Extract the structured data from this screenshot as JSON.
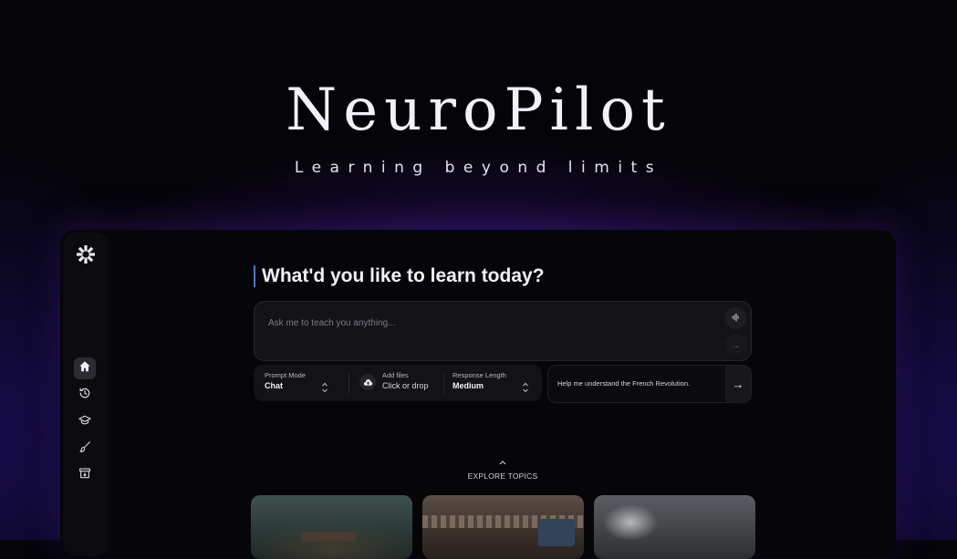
{
  "brand": {
    "title": "NeuroPilot",
    "tagline": "Learning beyond limits"
  },
  "sidebar": {
    "logo_icon": "asterisk-logo-icon",
    "items": [
      {
        "name": "home",
        "icon": "home-icon",
        "active": true
      },
      {
        "name": "history",
        "icon": "history-icon",
        "active": false
      },
      {
        "name": "courses",
        "icon": "graduation-cap-icon",
        "active": false
      },
      {
        "name": "create",
        "icon": "brush-icon",
        "active": false
      },
      {
        "name": "archive",
        "icon": "archive-icon",
        "active": false
      }
    ]
  },
  "main": {
    "heading": "What'd you like to learn today?",
    "prompt": {
      "placeholder": "Ask me to teach you anything...",
      "value": ""
    },
    "options": {
      "prompt_mode": {
        "label": "Prompt Mode",
        "value": "Chat"
      },
      "add_files": {
        "label": "Add files",
        "value": "Click or drop"
      },
      "response_length": {
        "label": "Response Length",
        "value": "Medium"
      }
    },
    "suggestion": "Help me understand the French Revolution.",
    "explore_label": "EXPLORE TOPICS"
  },
  "colors": {
    "accent": "#4f74c8",
    "background": "#050409",
    "glow": "#6028c8",
    "panel": "#131318"
  }
}
